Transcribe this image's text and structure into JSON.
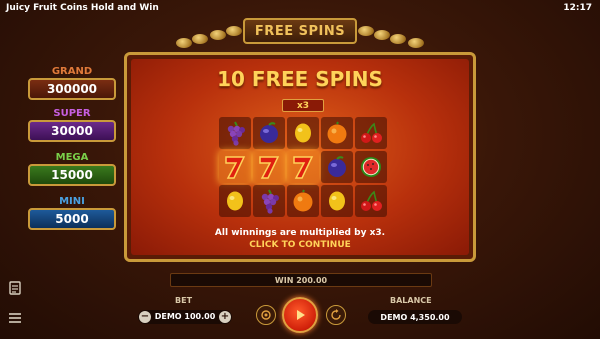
{
  "app": {
    "title": "Juicy Fruit Coins Hold and Win",
    "clock": "12:17"
  },
  "header": {
    "badge": "FREE SPINS"
  },
  "jackpots": [
    {
      "label": "GRAND",
      "value": "300000"
    },
    {
      "label": "SUPER",
      "value": "30000"
    },
    {
      "label": "MEGA",
      "value": "15000"
    },
    {
      "label": "MINI",
      "value": "5000"
    }
  ],
  "popup": {
    "title": "10 FREE SPINS",
    "multiplier": "x3",
    "message": "All winnings are multiplied by x3.",
    "action": "CLICK TO CONTINUE"
  },
  "reels": [
    [
      "grapes",
      "plum",
      "lemon",
      "orange",
      "cherries"
    ],
    [
      "seven",
      "seven",
      "seven",
      "plum",
      "watermelon"
    ],
    [
      "lemon",
      "grapes",
      "orange",
      "lemon",
      "cherries"
    ]
  ],
  "win": {
    "text": "WIN 200.00"
  },
  "bet": {
    "label": "BET",
    "value": "DEMO 100.00",
    "minus": "−",
    "plus": "+"
  },
  "balance": {
    "label": "BALANCE",
    "value": "DEMO 4,350.00"
  },
  "icons": [
    "paytable-icon",
    "menu-icon",
    "autoplay-icon",
    "spin-icon",
    "turbo-icon"
  ],
  "colors": {
    "accent": "#ffd35a",
    "frame": "#c99a3a",
    "spin": "#d0200a"
  }
}
